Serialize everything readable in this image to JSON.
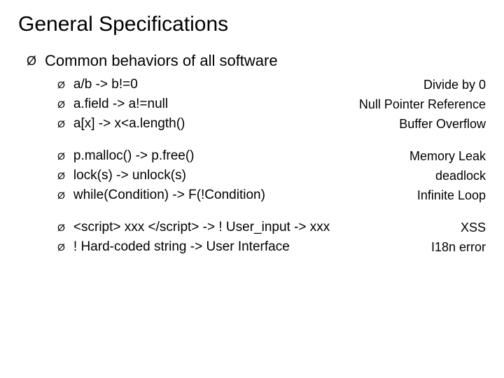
{
  "title": "General Specifications",
  "level1_text": "Common behaviors of all software",
  "items": [
    {
      "text": "a/b -> b!=0",
      "label": "Divide by 0",
      "gap": false
    },
    {
      "text": "a.field -> a!=null",
      "label": "Null Pointer Reference",
      "gap": false
    },
    {
      "text": "a[x] -> x<a.length()",
      "label": "Buffer Overflow",
      "gap": false
    },
    {
      "text": "p.malloc() -> p.free()",
      "label": "Memory Leak",
      "gap": true
    },
    {
      "text": "lock(s) -> unlock(s)",
      "label": "deadlock",
      "gap": false
    },
    {
      "text": "while(Condition) -> F(!Condition)",
      "label": "Infinite Loop",
      "gap": false
    },
    {
      "text": "<script> xxx </script> -> ! User_input -> xxx",
      "label": "XSS",
      "gap": true
    },
    {
      "text": "! Hard-coded string -> User Interface",
      "label": "I18n error",
      "gap": false
    }
  ],
  "glyphs": {
    "bullet": "Ø"
  }
}
